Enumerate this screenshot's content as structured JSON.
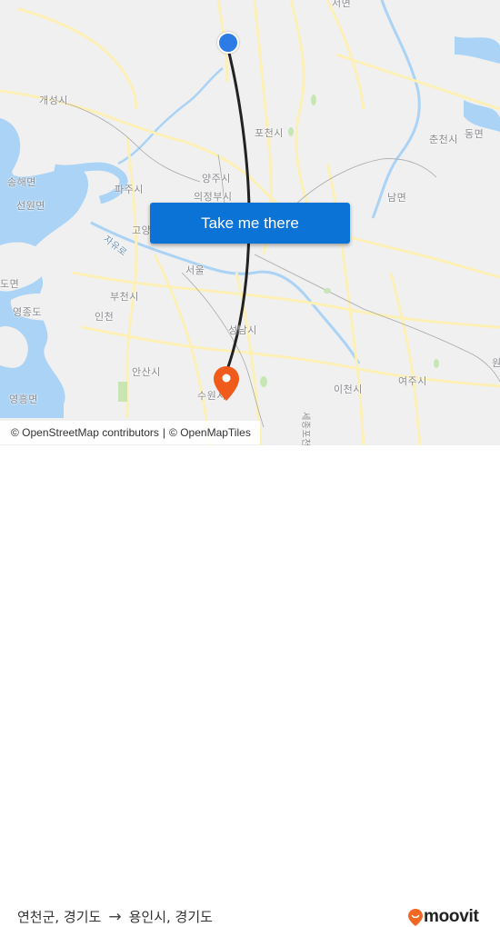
{
  "map": {
    "places": [
      {
        "id": "seomyeon",
        "label": "서면"
      },
      {
        "id": "gaeseong",
        "label": "개성시"
      },
      {
        "id": "pocheon",
        "label": "포천시"
      },
      {
        "id": "chuncheon",
        "label": "춘천시"
      },
      {
        "id": "dongmyeon",
        "label": "동면"
      },
      {
        "id": "songhae",
        "label": "송해면"
      },
      {
        "id": "paju",
        "label": "파주시"
      },
      {
        "id": "yangju",
        "label": "양주시"
      },
      {
        "id": "uijeongbu",
        "label": "의정부시"
      },
      {
        "id": "seonwon",
        "label": "선원면"
      },
      {
        "id": "nammyeon",
        "label": "남면"
      },
      {
        "id": "goyang",
        "label": "고양"
      },
      {
        "id": "seoul",
        "label": "서울"
      },
      {
        "id": "domyeon",
        "label": "도면"
      },
      {
        "id": "bucheon",
        "label": "부천시"
      },
      {
        "id": "yeongjong",
        "label": "영종도"
      },
      {
        "id": "incheon",
        "label": "인천"
      },
      {
        "id": "seongnam",
        "label": "성남시"
      },
      {
        "id": "ansan",
        "label": "안산시"
      },
      {
        "id": "icheon",
        "label": "이천시"
      },
      {
        "id": "yeoju",
        "label": "여주시"
      },
      {
        "id": "suwon",
        "label": "수원시"
      },
      {
        "id": "yeongheung",
        "label": "영흥면"
      },
      {
        "id": "won",
        "label": "원"
      }
    ],
    "roads": [
      {
        "id": "jayuro",
        "label": "자유로"
      },
      {
        "id": "sejong",
        "label": "세종포천"
      }
    ],
    "origin_marker": {
      "label": "연천군, 경기도",
      "color": "#2d7be5"
    },
    "destination_marker": {
      "label": "용인시, 경기도",
      "color": "#f05a1a"
    },
    "route_color": "#222222"
  },
  "cta": {
    "label": "Take me there",
    "color": "#0b72d6"
  },
  "attribution": {
    "osm": "© OpenStreetMap contributors",
    "separator": "|",
    "omt": "© OpenMapTiles"
  },
  "footer": {
    "origin": "연천군, 경기도",
    "arrow": "→",
    "destination": "용인시, 경기도",
    "logo": "moovit",
    "logo_color": "#f26722"
  }
}
